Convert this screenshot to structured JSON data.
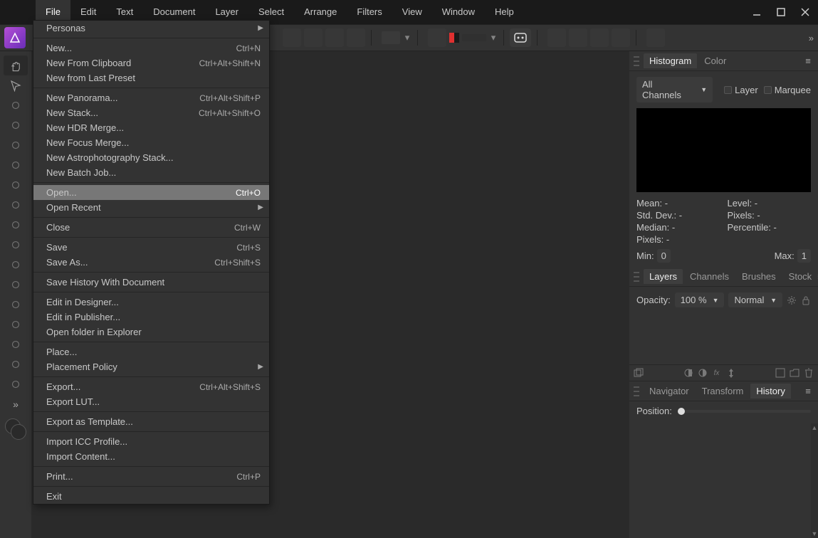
{
  "menubar": [
    "File",
    "Edit",
    "Text",
    "Document",
    "Layer",
    "Select",
    "Arrange",
    "Filters",
    "View",
    "Window",
    "Help"
  ],
  "menubar_active_index": 0,
  "file_menu": [
    {
      "type": "item",
      "label": "Personas",
      "submenu": true
    },
    {
      "type": "sep"
    },
    {
      "type": "item",
      "label": "New...",
      "shortcut": "Ctrl+N"
    },
    {
      "type": "item",
      "label": "New From Clipboard",
      "shortcut": "Ctrl+Alt+Shift+N"
    },
    {
      "type": "item",
      "label": "New from Last Preset"
    },
    {
      "type": "sep"
    },
    {
      "type": "item",
      "label": "New Panorama...",
      "shortcut": "Ctrl+Alt+Shift+P"
    },
    {
      "type": "item",
      "label": "New Stack...",
      "shortcut": "Ctrl+Alt+Shift+O"
    },
    {
      "type": "item",
      "label": "New HDR Merge..."
    },
    {
      "type": "item",
      "label": "New Focus Merge..."
    },
    {
      "type": "item",
      "label": "New Astrophotography Stack..."
    },
    {
      "type": "item",
      "label": "New Batch Job..."
    },
    {
      "type": "sep"
    },
    {
      "type": "item",
      "label": "Open...",
      "shortcut": "Ctrl+O",
      "highlight": true
    },
    {
      "type": "item",
      "label": "Open Recent",
      "submenu": true
    },
    {
      "type": "sep"
    },
    {
      "type": "item",
      "label": "Close",
      "shortcut": "Ctrl+W",
      "disabled": true
    },
    {
      "type": "sep"
    },
    {
      "type": "item",
      "label": "Save",
      "shortcut": "Ctrl+S",
      "disabled": true
    },
    {
      "type": "item",
      "label": "Save As...",
      "shortcut": "Ctrl+Shift+S",
      "disabled": true
    },
    {
      "type": "sep"
    },
    {
      "type": "item",
      "label": "Save History With Document",
      "disabled": true
    },
    {
      "type": "sep"
    },
    {
      "type": "item",
      "label": "Edit in Designer...",
      "disabled": true
    },
    {
      "type": "item",
      "label": "Edit in Publisher...",
      "disabled": true
    },
    {
      "type": "item",
      "label": "Open folder in Explorer",
      "disabled": true
    },
    {
      "type": "sep"
    },
    {
      "type": "item",
      "label": "Place...",
      "disabled": true
    },
    {
      "type": "item",
      "label": "Placement Policy",
      "submenu": true
    },
    {
      "type": "sep"
    },
    {
      "type": "item",
      "label": "Export...",
      "shortcut": "Ctrl+Alt+Shift+S",
      "disabled": true
    },
    {
      "type": "item",
      "label": "Export LUT...",
      "disabled": true
    },
    {
      "type": "sep"
    },
    {
      "type": "item",
      "label": "Export as Template...",
      "disabled": true
    },
    {
      "type": "sep"
    },
    {
      "type": "item",
      "label": "Import ICC Profile..."
    },
    {
      "type": "item",
      "label": "Import Content..."
    },
    {
      "type": "sep"
    },
    {
      "type": "item",
      "label": "Print...",
      "shortcut": "Ctrl+P",
      "disabled": true
    },
    {
      "type": "sep"
    },
    {
      "type": "item",
      "label": "Exit"
    }
  ],
  "tools": [
    "hand",
    "move",
    "freehand",
    "crop",
    "brush-select",
    "flood-select",
    "marquee",
    "paint",
    "heal",
    "clone",
    "eraser",
    "smudge",
    "dodge",
    "sponge",
    "mesh",
    "blur",
    "eyedropper"
  ],
  "histogram_panel": {
    "tabs": [
      "Histogram",
      "Color"
    ],
    "active_tab": 0,
    "channel_select": "All Channels",
    "checkbox_layer": "Layer",
    "checkbox_marquee": "Marquee",
    "stats": {
      "mean": "Mean: -",
      "stddev": "Std. Dev.: -",
      "median": "Median: -",
      "pixels1": "Pixels: -",
      "level": "Level: -",
      "pixels2": "Pixels: -",
      "percentile": "Percentile: -"
    },
    "min_label": "Min:",
    "min_value": "0",
    "max_label": "Max:",
    "max_value": "1"
  },
  "layers_panel": {
    "tabs": [
      "Layers",
      "Channels",
      "Brushes",
      "Stock"
    ],
    "active_tab": 0,
    "opacity_label": "Opacity:",
    "opacity_value": "100 %",
    "blend_mode": "Normal"
  },
  "history_panel": {
    "tabs": [
      "Navigator",
      "Transform",
      "History"
    ],
    "active_tab": 2,
    "position_label": "Position:"
  }
}
